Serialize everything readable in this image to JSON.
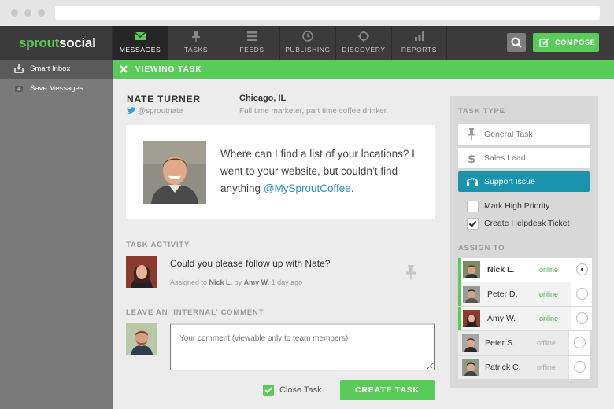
{
  "app": {
    "logo_part1": "sprout",
    "logo_part2": "social"
  },
  "nav": {
    "tabs": [
      {
        "label": "MESSAGES",
        "icon": "envelope-icon",
        "active": true
      },
      {
        "label": "TASKS",
        "icon": "pin-icon",
        "active": false
      },
      {
        "label": "FEEDS",
        "icon": "list-icon",
        "active": false
      },
      {
        "label": "PUBLISHING",
        "icon": "paper-plane-icon",
        "active": false
      },
      {
        "label": "DISCOVERY",
        "icon": "compass-icon",
        "active": false
      },
      {
        "label": "REPORTS",
        "icon": "bar-chart-icon",
        "active": false
      }
    ],
    "compose_label": "COMPOSE"
  },
  "sidebar": {
    "items": [
      {
        "label": "Smart Inbox",
        "icon": "inbox-icon",
        "active": true
      },
      {
        "label": "Save Messages",
        "icon": "save-icon",
        "active": false
      }
    ]
  },
  "task_bar": {
    "title": "VIEWING TASK"
  },
  "author": {
    "name": "NATE TURNER",
    "handle": "@sproutnate",
    "location": "Chicago, IL",
    "bio": "Full time marketer, part time coffee drinker."
  },
  "message": {
    "text": "Where can I find a list of your locations? I went to your website, but couldn’t find anything",
    "mention": "@MySproutCoffee",
    "end": "."
  },
  "activity": {
    "section_label": "TASK ACTIVITY",
    "text": "Could you please follow up with Nate?",
    "meta_prefix": "Assigned to",
    "assignee": "Nick L.",
    "meta_by": "by",
    "assigner": "Amy W.",
    "time": "1 day ago"
  },
  "comment": {
    "section_label": "LEAVE AN ‘INTERNAL’ COMMENT",
    "placeholder": "Your comment (viewable only to team members)",
    "close_task_label": "Close Task",
    "create_task_label": "CREATE TASK"
  },
  "task_panel": {
    "type_label": "TASK TYPE",
    "types": [
      {
        "label": "General Task",
        "icon": "pin-icon",
        "selected": false
      },
      {
        "label": "Sales Lead",
        "icon": "dollar-icon",
        "selected": false
      },
      {
        "label": "Support Issue",
        "icon": "headset-icon",
        "selected": true
      }
    ],
    "options": [
      {
        "label": "Mark High Priority",
        "checked": false
      },
      {
        "label": "Create Helpdesk Ticket",
        "checked": true
      }
    ],
    "assign_label": "ASSIGN TO",
    "agents": [
      {
        "name": "Nick L.",
        "status": "online",
        "selected": true
      },
      {
        "name": "Peter D.",
        "status": "online",
        "selected": false
      },
      {
        "name": "Amy W.",
        "status": "online",
        "selected": false
      },
      {
        "name": "Peter S.",
        "status": "offline",
        "selected": false
      },
      {
        "name": "Patrick C.",
        "status": "offline",
        "selected": false
      }
    ]
  },
  "colors": {
    "brand_green": "#59cb59",
    "support_blue": "#1a93ad",
    "nav_dark": "#3b3b3b",
    "mention_blue": "#2a8fbd"
  }
}
